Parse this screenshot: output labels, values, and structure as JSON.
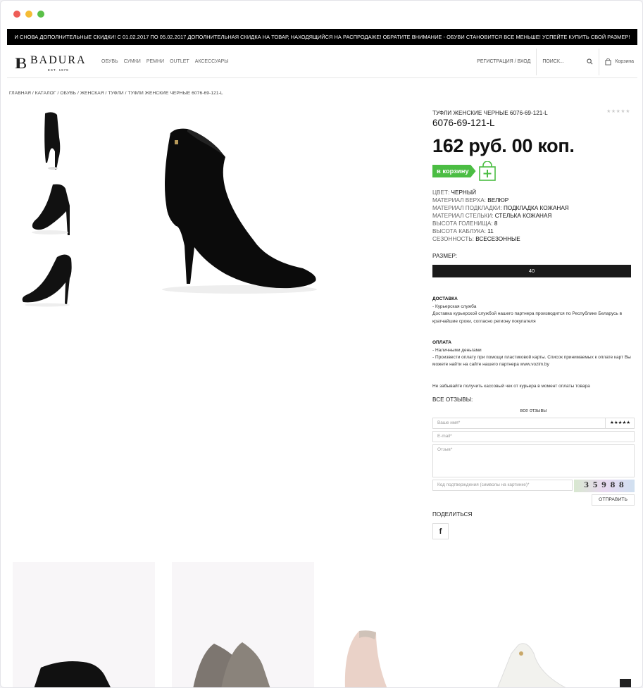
{
  "promo": "И СНОВА ДОПОЛНИТЕЛЬНЫЕ СКИДКИ! С 01.02.2017 ПО 05.02.2017 ДОПОЛНИТЕЛЬНАЯ СКИДКА НА ТОВАР, НАХОДЯЩИЙСЯ НА РАСПРОДАЖЕ! ОБРАТИТЕ ВНИМАНИЕ - ОБУВИ СТАНОВИТСЯ ВСЕ МЕНЬШЕ! УСПЕЙТЕ КУПИТЬ СВОЙ РАЗМЕР!",
  "logo": {
    "mark": "IB",
    "name": "BADURA",
    "est": "EST. 1979"
  },
  "nav": [
    "ОБУВЬ",
    "СУМКИ",
    "РЕМНИ",
    "OUTLET",
    "АКСЕССУАРЫ"
  ],
  "header": {
    "register": "РЕГИСТРАЦИЯ / ВХОД",
    "search_placeholder": "ПОИСК...",
    "cart": "Корзина"
  },
  "breadcrumb": "ГЛАВНАЯ / КАТАЛОГ / ОБУВЬ / ЖЕНСКАЯ / ТУФЛИ / ТУФЛИ ЖЕНСКИЕ ЧЕРНЫЕ 6076-69-121-L",
  "product": {
    "title": "ТУФЛИ ЖЕНСКИЕ ЧЕРНЫЕ 6076-69-121-L",
    "stars": "★★★★★",
    "sku": "6076-69-121-L",
    "price": "162 руб. 00 коп.",
    "buy": "в корзину",
    "attrs": [
      {
        "k": "ЦВЕТ:",
        "v": "ЧЕРНЫЙ"
      },
      {
        "k": "МАТЕРИАЛ ВЕРХА:",
        "v": "ВЕЛЮР"
      },
      {
        "k": "МАТЕРИАЛ ПОДКЛАДКИ:",
        "v": "ПОДКЛАДКА КОЖАНАЯ"
      },
      {
        "k": "МАТЕРИАЛ СТЕЛЬКИ:",
        "v": "СТЕЛЬКА КОЖАНАЯ"
      },
      {
        "k": "ВЫСОТА ГОЛЕНИЩА:",
        "v": "8"
      },
      {
        "k": "ВЫСОТА КАБЛУКА:",
        "v": "11"
      },
      {
        "k": "СЕЗОННОСТЬ:",
        "v": "ВСЕСЕЗОННЫЕ"
      }
    ],
    "size_label": "РАЗМЕР:",
    "size": "40"
  },
  "delivery": {
    "title": "ДОСТАВКА",
    "l1": "- Курьерская служба",
    "l2": "Доставка курьерской службой нашего партнера производится по Республике Беларусь в кратчайшие сроки, согласно региону покупателя"
  },
  "payment": {
    "title": "ОПЛАТА",
    "l1": "- Наличными деньгами",
    "l2": "- Произвести оплату при помощи пластиковой карты. Список принимаемых к оплате карт Вы можете найти на сайте нашего партнера www.vozim.by"
  },
  "note": "Не забывайте получить кассовый чек от курьера в момент оплаты товара",
  "reviews": {
    "title": "ВСЕ ОТЗЫВЫ:",
    "all": "все отзывы",
    "name_ph": "Ваше имя*",
    "stars": "★★★★★",
    "email_ph": "E-mail*",
    "review_ph": "Отзыв*",
    "captcha_ph": "Код подтверждения (символы на картинке)*",
    "captcha": "3 5 9 8 8",
    "submit": "ОТПРАВИТЬ"
  },
  "share": {
    "title": "ПОДЕЛИТЬСЯ",
    "fb": "f"
  },
  "colors": {
    "buy": "#4bbd43",
    "dark": "#1a1a1a"
  }
}
